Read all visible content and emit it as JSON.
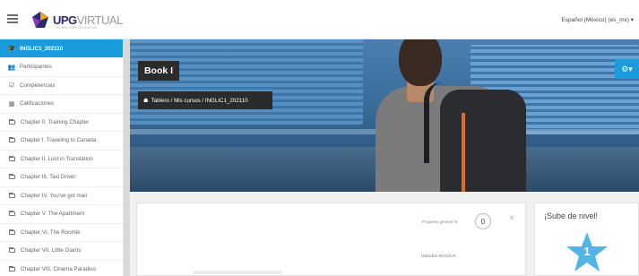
{
  "header": {
    "logo_main": "UPG",
    "logo_virtual": "VIRTUAL",
    "logo_tagline": "TECNOLOGÍA EDUCATIVA",
    "language": "Español (México) (es_mx) ▾"
  },
  "sidebar": {
    "items": [
      {
        "label": "INGLIC1_202110",
        "icon": "graduation-cap-icon",
        "active": true
      },
      {
        "label": "Participantes",
        "icon": "users-icon"
      },
      {
        "label": "Competencias",
        "icon": "checkbox-icon"
      },
      {
        "label": "Calificaciones",
        "icon": "table-icon"
      },
      {
        "label": "Chapter 0. Training Chapter",
        "icon": "folder-icon"
      },
      {
        "label": "Chapter I. Traveling to Canada",
        "icon": "folder-icon"
      },
      {
        "label": "Chapter II. Lost in Translation",
        "icon": "folder-icon"
      },
      {
        "label": "Chapter III. Taxi Driver",
        "icon": "folder-icon"
      },
      {
        "label": "Chapter IV. You've got mail",
        "icon": "folder-icon"
      },
      {
        "label": "Chapter V. The Apartment",
        "icon": "folder-icon"
      },
      {
        "label": "Chapter VI. The Roomie",
        "icon": "folder-icon"
      },
      {
        "label": "Chapter VII. Little Giants",
        "icon": "folder-icon"
      },
      {
        "label": "Chapter VIII. Cinema Paradiso",
        "icon": "folder-icon"
      }
    ]
  },
  "course": {
    "title": "Book I",
    "breadcrumb": [
      "Tablero",
      "Mis cursos",
      "INGLIC1_202110"
    ],
    "breadcrumb_sep": "/"
  },
  "progress": {
    "label": "Progreso general %",
    "value": "0",
    "close": "×",
    "section": "INGLÉS BÁSICO"
  },
  "level": {
    "title": "¡Sube de nivel!",
    "number": "1"
  },
  "colors": {
    "accent": "#1a9bdb",
    "star": "#4fb6e6"
  }
}
